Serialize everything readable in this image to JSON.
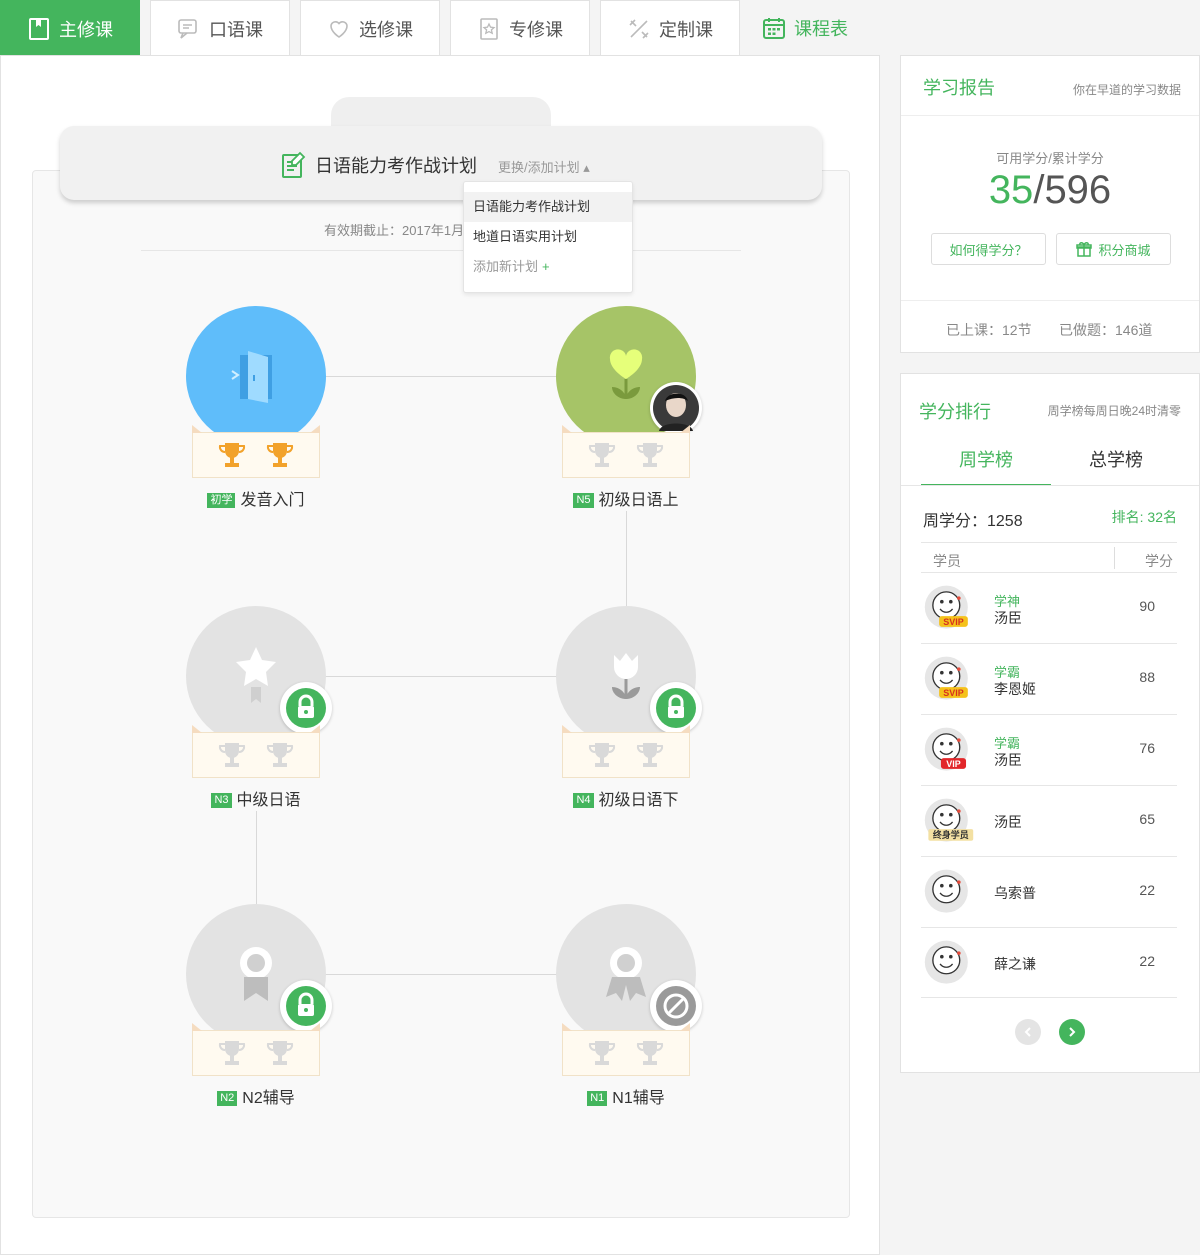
{
  "tabs": [
    {
      "label": "主修课",
      "icon": "book-icon",
      "active": true
    },
    {
      "label": "口语课",
      "icon": "chat-icon"
    },
    {
      "label": "选修课",
      "icon": "heart-icon"
    },
    {
      "label": "专修课",
      "icon": "star-doc-icon"
    },
    {
      "label": "定制课",
      "icon": "tools-icon"
    },
    {
      "label": "课程表",
      "icon": "calendar-icon"
    }
  ],
  "plan": {
    "title": "日语能力考作战计划",
    "switch_label": "更换/添加计划 ▴",
    "validity": "有效期截止：2017年1月",
    "dropdown": [
      "日语能力考作战计划",
      "地道日语实用计划"
    ],
    "add_label": "添加新计划",
    "add_symbol": "+"
  },
  "courses": [
    {
      "level": "初学",
      "name": "发音入门",
      "state": "done"
    },
    {
      "level": "N5",
      "name": "初级日语上",
      "state": "current"
    },
    {
      "level": "N3",
      "name": "中级日语",
      "state": "locked"
    },
    {
      "level": "N4",
      "name": "初级日语下",
      "state": "locked"
    },
    {
      "level": "N2",
      "name": "N2辅导",
      "state": "locked"
    },
    {
      "level": "N1",
      "name": "N1辅导",
      "state": "disabled"
    }
  ],
  "report": {
    "title": "学习报告",
    "subtitle": "你在早道的学习数据",
    "caption": "可用学分/累计学分",
    "available": "35",
    "slash": "/",
    "total": "596",
    "how_button": "如何得学分？",
    "mall_button": "积分商城",
    "attended": "已上课：12节",
    "questions": "已做题：146道"
  },
  "ranking": {
    "title": "学分排行",
    "subtitle": "周学榜每周日晚24时清零",
    "tab_week": "周学榜",
    "tab_total": "总学榜",
    "my_score": "周学分：1258",
    "my_rank": "排名: 32名",
    "col_student": "学员",
    "col_score": "学分",
    "rows": [
      {
        "tag": "学神",
        "name": "汤臣",
        "score": "90",
        "badge": "SVIP"
      },
      {
        "tag": "学霸",
        "name": "李恩姬",
        "score": "88",
        "badge": "SVIP"
      },
      {
        "tag": "学霸",
        "name": "汤臣",
        "score": "76",
        "badge": "VIP"
      },
      {
        "tag": "",
        "name": "汤臣",
        "score": "65",
        "badge": "终身学员"
      },
      {
        "tag": "",
        "name": "乌索普",
        "score": "22",
        "badge": ""
      },
      {
        "tag": "",
        "name": "薛之谦",
        "score": "22",
        "badge": ""
      }
    ]
  },
  "colors": {
    "accent": "#44b55d",
    "sky": "#5fbdfa",
    "olive": "#a6c467",
    "gray": "#e3e3e3"
  }
}
